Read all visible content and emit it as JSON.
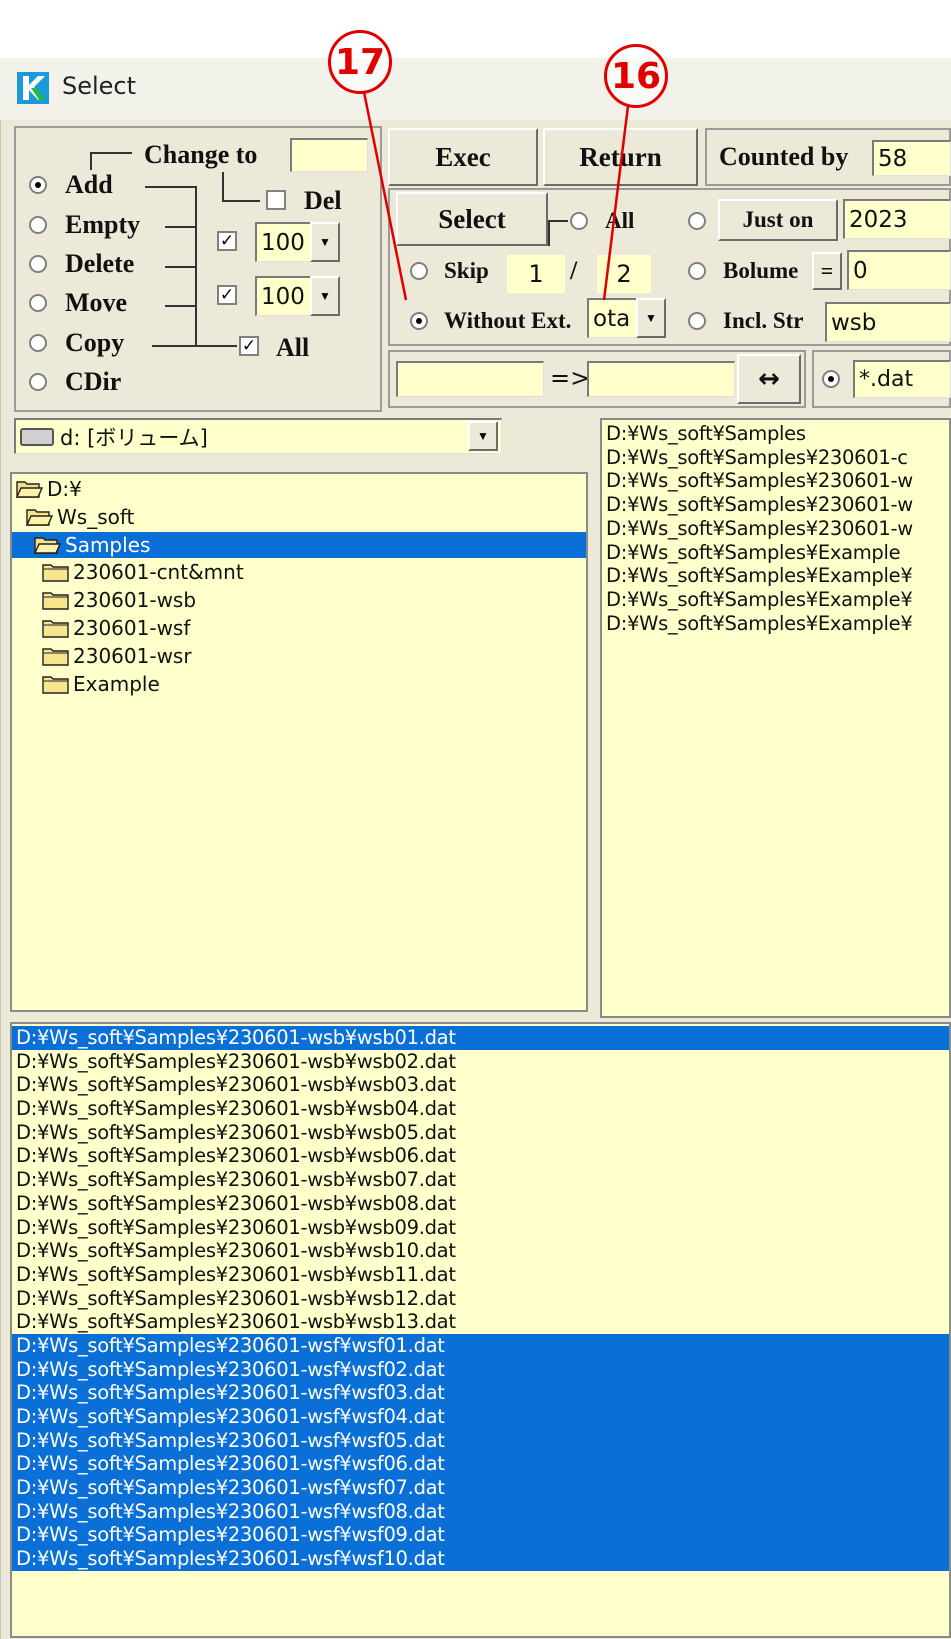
{
  "window": {
    "title": "Select"
  },
  "mode_group": {
    "change_to_label": "Change to",
    "change_to_value": "",
    "del_label": "Del",
    "all_label": "All",
    "spin1_value": "100",
    "spin2_value": "100",
    "options": [
      "Add",
      "Empty",
      "Delete",
      "Move",
      "Copy",
      "CDir"
    ],
    "selected": "Add"
  },
  "toolbar": {
    "exec_label": "Exec",
    "return_label": "Return",
    "counted_by_label": "Counted by",
    "counted_by_value": "58"
  },
  "select_group": {
    "select_label": "Select",
    "all_label": "All",
    "just_on_label": "Just on",
    "just_on_value": "2023",
    "skip_label": "Skip",
    "skip_value": "1",
    "skip_sep": "/",
    "skip_value2": "2",
    "bolume_label": "Bolume",
    "bolume_op": "=",
    "bolume_value": "0",
    "without_ext_label": "Without Ext.",
    "ext_value": "ota",
    "incl_str_label": "Incl. Str",
    "incl_str_value": "wsb"
  },
  "rename_row": {
    "from_value": "",
    "arrow_label": "=>",
    "to_value": "",
    "swap_label": "↔",
    "filter_value": "*.dat"
  },
  "drive": {
    "value": "d: [ボリューム]"
  },
  "tree": [
    {
      "label": "D:¥",
      "selected": false
    },
    {
      "label": "Ws_soft",
      "selected": false
    },
    {
      "label": "Samples",
      "selected": true
    },
    {
      "label": "230601-cnt&mnt",
      "selected": false
    },
    {
      "label": "230601-wsb",
      "selected": false
    },
    {
      "label": "230601-wsf",
      "selected": false
    },
    {
      "label": "230601-wsr",
      "selected": false
    },
    {
      "label": "Example",
      "selected": false
    }
  ],
  "path_list": [
    "D:¥Ws_soft¥Samples",
    "D:¥Ws_soft¥Samples¥230601-c",
    "D:¥Ws_soft¥Samples¥230601-w",
    "D:¥Ws_soft¥Samples¥230601-w",
    "D:¥Ws_soft¥Samples¥230601-w",
    "D:¥Ws_soft¥Samples¥Example",
    "D:¥Ws_soft¥Samples¥Example¥",
    "D:¥Ws_soft¥Samples¥Example¥",
    "D:¥Ws_soft¥Samples¥Example¥"
  ],
  "files": [
    {
      "path": "D:¥Ws_soft¥Samples¥230601-wsb¥wsb01.dat",
      "selected": true
    },
    {
      "path": "D:¥Ws_soft¥Samples¥230601-wsb¥wsb02.dat",
      "selected": false
    },
    {
      "path": "D:¥Ws_soft¥Samples¥230601-wsb¥wsb03.dat",
      "selected": false
    },
    {
      "path": "D:¥Ws_soft¥Samples¥230601-wsb¥wsb04.dat",
      "selected": false
    },
    {
      "path": "D:¥Ws_soft¥Samples¥230601-wsb¥wsb05.dat",
      "selected": false
    },
    {
      "path": "D:¥Ws_soft¥Samples¥230601-wsb¥wsb06.dat",
      "selected": false
    },
    {
      "path": "D:¥Ws_soft¥Samples¥230601-wsb¥wsb07.dat",
      "selected": false
    },
    {
      "path": "D:¥Ws_soft¥Samples¥230601-wsb¥wsb08.dat",
      "selected": false
    },
    {
      "path": "D:¥Ws_soft¥Samples¥230601-wsb¥wsb09.dat",
      "selected": false
    },
    {
      "path": "D:¥Ws_soft¥Samples¥230601-wsb¥wsb10.dat",
      "selected": false
    },
    {
      "path": "D:¥Ws_soft¥Samples¥230601-wsb¥wsb11.dat",
      "selected": false
    },
    {
      "path": "D:¥Ws_soft¥Samples¥230601-wsb¥wsb12.dat",
      "selected": false
    },
    {
      "path": "D:¥Ws_soft¥Samples¥230601-wsb¥wsb13.dat",
      "selected": false
    },
    {
      "path": "D:¥Ws_soft¥Samples¥230601-wsf¥wsf01.dat",
      "selected": true
    },
    {
      "path": "D:¥Ws_soft¥Samples¥230601-wsf¥wsf02.dat",
      "selected": true
    },
    {
      "path": "D:¥Ws_soft¥Samples¥230601-wsf¥wsf03.dat",
      "selected": true
    },
    {
      "path": "D:¥Ws_soft¥Samples¥230601-wsf¥wsf04.dat",
      "selected": true
    },
    {
      "path": "D:¥Ws_soft¥Samples¥230601-wsf¥wsf05.dat",
      "selected": true
    },
    {
      "path": "D:¥Ws_soft¥Samples¥230601-wsf¥wsf06.dat",
      "selected": true
    },
    {
      "path": "D:¥Ws_soft¥Samples¥230601-wsf¥wsf07.dat",
      "selected": true
    },
    {
      "path": "D:¥Ws_soft¥Samples¥230601-wsf¥wsf08.dat",
      "selected": true
    },
    {
      "path": "D:¥Ws_soft¥Samples¥230601-wsf¥wsf09.dat",
      "selected": true
    },
    {
      "path": "D:¥Ws_soft¥Samples¥230601-wsf¥wsf10.dat",
      "selected": true
    }
  ],
  "annotations": {
    "a17": "17",
    "a16": "16",
    "color": "#e00000"
  },
  "colors": {
    "selection": "#0a6fd6",
    "field": "#ffffcc",
    "face": "#ece9d8"
  }
}
